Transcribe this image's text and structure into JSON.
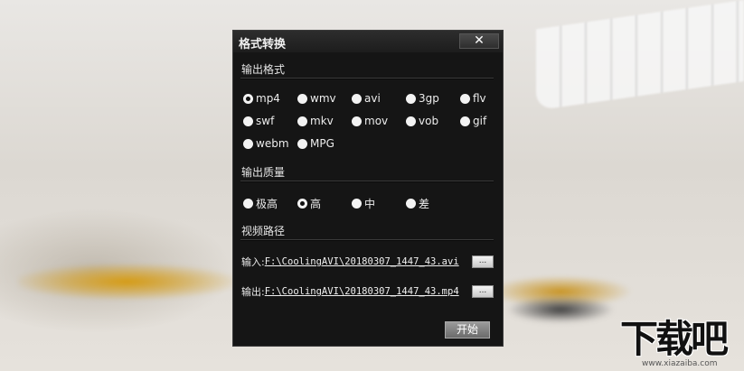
{
  "window": {
    "title": "格式转换",
    "close_label": "✕"
  },
  "output_format": {
    "label": "输出格式",
    "selected": "mp4",
    "options": [
      "mp4",
      "wmv",
      "avi",
      "3gp",
      "flv",
      "swf",
      "mkv",
      "mov",
      "vob",
      "gif",
      "webm",
      "MPG"
    ]
  },
  "output_quality": {
    "label": "输出质量",
    "selected": "高",
    "options": [
      "极高",
      "高",
      "中",
      "差"
    ]
  },
  "video_path": {
    "label": "视频路径",
    "input_label": "输入:",
    "input_value": "F:\\CoolingAVI\\20180307_1447_43.avi",
    "output_label": "输出:",
    "output_value": "F:\\CoolingAVI\\20180307_1447_43.mp4",
    "browse_label": "..."
  },
  "actions": {
    "start_label": "开始"
  },
  "watermark": {
    "logo_text": "下载吧",
    "url": "www.xiazaiba.com"
  }
}
